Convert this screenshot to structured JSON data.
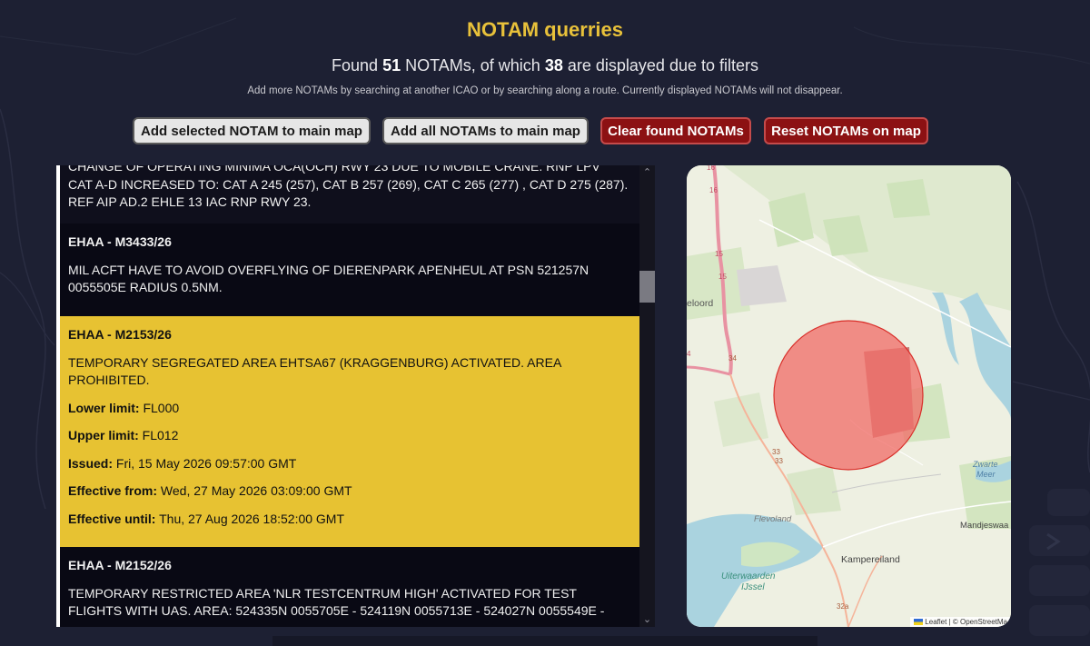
{
  "header": {
    "title": "NOTAM querries",
    "found_prefix": "Found",
    "found_count": "51",
    "found_middle": "NOTAMs, of which",
    "displayed_count": "38",
    "found_suffix": "are displayed due to filters",
    "hint": "Add more NOTAMs by searching at another ICAO or by searching along a route. Currently displayed NOTAMs will not disappear."
  },
  "buttons": {
    "add_selected": "Add selected NOTAM to main map",
    "add_all": "Add all NOTAMs to main map",
    "clear_found": "Clear found NOTAMs",
    "reset": "Reset NOTAMs on map"
  },
  "notams": [
    {
      "text_cut": "CHANGE OF OPERATING MINIMA OCA(OCH) RWY 23 DUE TO MOBILE CRANE. RNP LPV",
      "text": "CAT A-D INCREASED TO: CAT A 245 (257), CAT B 257 (269), CAT C 265 (277) , CAT D 275 (287). REF AIP AD.2 EHLE 13 IAC RNP RWY 23."
    },
    {
      "id": "EHAA - M3433/26",
      "text": "MIL ACFT HAVE TO AVOID OVERFLYING OF DIERENPARK APENHEUL AT PSN 521257N 0055505E RADIUS 0.5NM."
    },
    {
      "id": "EHAA - M2153/26",
      "text": "TEMPORARY SEGREGATED AREA EHTSA67 (KRAGGENBURG) ACTIVATED. AREA PROHIBITED.",
      "lower_label": "Lower limit:",
      "lower": "FL000",
      "upper_label": "Upper limit:",
      "upper": "FL012",
      "issued_label": "Issued:",
      "issued": "Fri, 15 May 2026 09:57:00 GMT",
      "from_label": "Effective from:",
      "from": "Wed, 27 May 2026 03:09:00 GMT",
      "until_label": "Effective until:",
      "until": "Thu, 27 Aug 2026 18:52:00 GMT"
    },
    {
      "id": "EHAA - M2152/26",
      "text": "TEMPORARY RESTRICTED AREA 'NLR TESTCENTRUM HIGH' ACTIVATED FOR TEST FLIGHTS WITH UAS. AREA: 524335N 0055705E - 524119N 0055713E - 524027N 0055549E -"
    }
  ],
  "map": {
    "labels": {
      "eloord": "eloord",
      "flevoland": "Flevoland",
      "kampereiland": "Kampereiland",
      "uiterwaarden_1": "Uiterwaarden",
      "uiterwaarden_2": "IJssel",
      "zwarte_1": "Zwarte",
      "zwarte_2": "Meer",
      "mandjeswaard": "Mandjeswaa",
      "r16a": "16",
      "r16b": "16",
      "r15a": "15",
      "r15b": "15",
      "r34": "34",
      "r4": "4",
      "r33a": "33",
      "r33b": "33",
      "r32a": "32a"
    },
    "attribution_leaflet": "Leaflet",
    "attribution_osm": " | © OpenStreetMa",
    "restricted_fill": "#f16f6a",
    "restricted_stroke": "#d92f2a"
  },
  "colors": {
    "title": "#e8c13a",
    "selected_row": "#e7c232",
    "red_button": "#8c1113"
  }
}
